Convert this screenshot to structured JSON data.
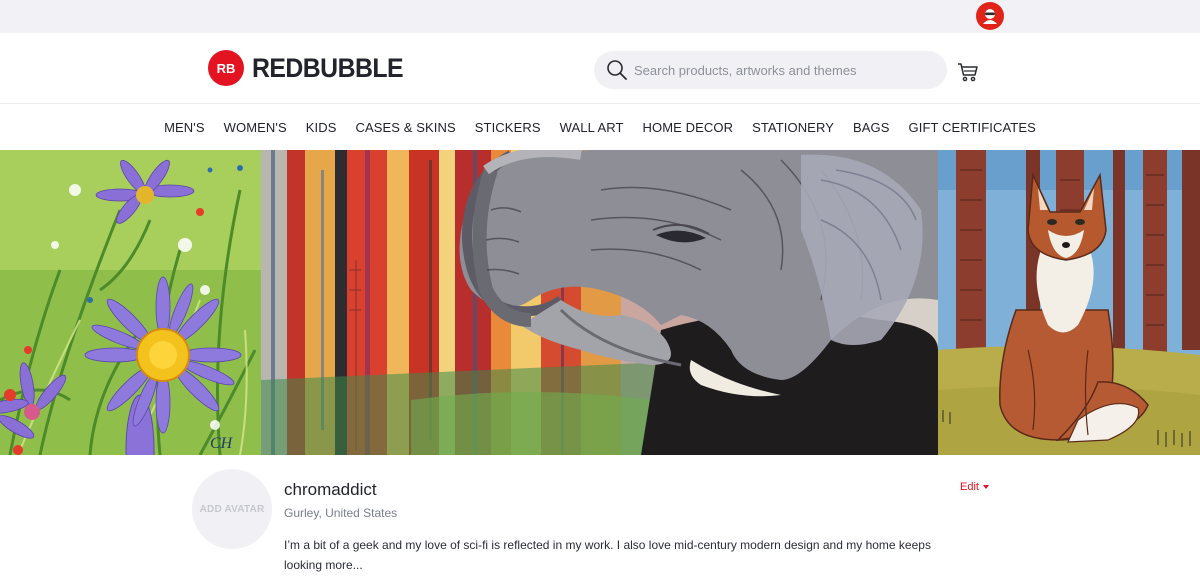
{
  "brand": {
    "name": "REDBUBBLE",
    "logo_mark_text": "RB",
    "accent_color": "#e41321"
  },
  "header": {
    "search_placeholder": "Search products, artworks and themes",
    "icons": {
      "search": "search-icon",
      "cart": "cart-icon",
      "user": "user-avatar-icon"
    }
  },
  "nav": {
    "items": [
      {
        "label": "MEN'S"
      },
      {
        "label": "WOMEN'S"
      },
      {
        "label": "KIDS"
      },
      {
        "label": "CASES & SKINS"
      },
      {
        "label": "STICKERS"
      },
      {
        "label": "WALL ART"
      },
      {
        "label": "HOME DECOR"
      },
      {
        "label": "STATIONERY"
      },
      {
        "label": "BAGS"
      },
      {
        "label": "GIFT CERTIFICATES"
      }
    ]
  },
  "banner": {
    "panels": [
      {
        "subject": "purple aster flowers painting"
      },
      {
        "subject": "elephant painting with colorful abstract background"
      },
      {
        "subject": "red fox sitting in forest painting"
      }
    ]
  },
  "profile": {
    "avatar_label": "ADD AVATAR",
    "username": "chromaddict",
    "location": "Gurley, United States",
    "bio": "I’m a bit of a geek and my love of sci-fi is reflected in my work. I also love mid-century modern design and my home keeps looking more...",
    "edit_label": "Edit"
  }
}
